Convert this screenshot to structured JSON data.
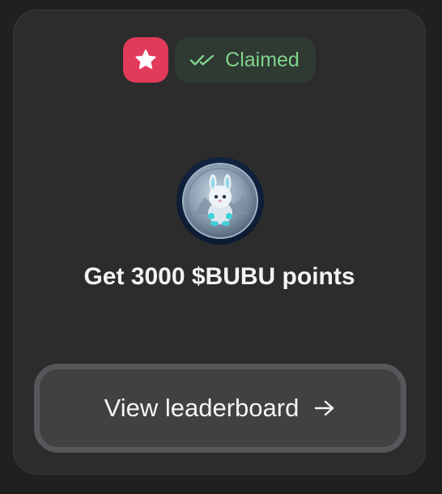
{
  "badge": {
    "icon": "star-icon",
    "status_icon": "double-check-icon",
    "status_label": "Claimed",
    "accent_color": "#e23a5b",
    "status_color": "#7fd38b"
  },
  "reward": {
    "image": "bubu-coin-image",
    "title": "Get 3000 $BUBU points"
  },
  "cta": {
    "label": "View leaderboard",
    "icon": "arrow-right-icon"
  }
}
